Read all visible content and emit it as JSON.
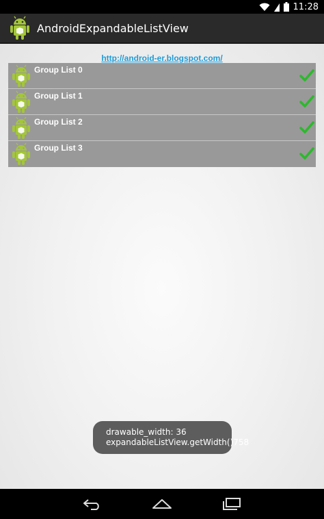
{
  "status_bar": {
    "time": "11:28",
    "icons": [
      "wifi-icon",
      "signal-icon",
      "battery-icon"
    ]
  },
  "action_bar": {
    "title": "AndroidExpandableListView",
    "icon": "android-icon"
  },
  "content": {
    "link_text": "http://android-er.blogspot.com/",
    "groups": [
      {
        "label": "Group List 0",
        "checked": true
      },
      {
        "label": "Group List 1",
        "checked": true
      },
      {
        "label": "Group List 2",
        "checked": true
      },
      {
        "label": "Group List 3",
        "checked": true
      }
    ]
  },
  "toast": {
    "line1": "drawable_width: 36",
    "line2": "expandableListView.getWidth()758"
  },
  "nav_bar": {
    "buttons": [
      "back-icon",
      "home-icon",
      "recents-icon"
    ]
  },
  "colors": {
    "link": "#1d9cd9",
    "group_bg": "#999999",
    "check": "#2db82d",
    "android_green": "#a4c639"
  }
}
